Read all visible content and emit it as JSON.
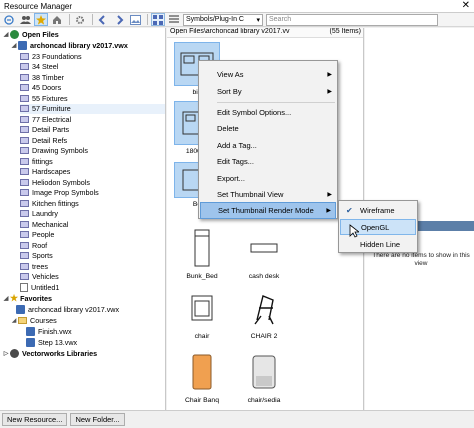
{
  "window": {
    "title": "Resource Manager",
    "close": "✕"
  },
  "toolbar": {
    "filter_label": "Symbols/Plug-In C",
    "search_placeholder": "Search"
  },
  "tree": {
    "open_files": "Open Files",
    "library": "archoncad library v2017.vwx",
    "folders": [
      "23 Foundations",
      "34 Steel",
      "38 Timber",
      "45 Doors",
      "55 Fixtures",
      "57 Furniture",
      "77 Electrical",
      "Detail Parts",
      "Detail Refs",
      "Drawing Symbols",
      "fittings",
      "Hardscapes",
      "Heliodon Symbols",
      "Image Prop Symbols",
      "Kitchen fittings",
      "Laundry",
      "Mechanical",
      "People",
      "Roof",
      "Sports",
      "trees",
      "Vehicles"
    ],
    "untitled": "Untitled1",
    "favorites": "Favorites",
    "fav_library": "archoncad library v2017.vwx",
    "courses": "Courses",
    "finish": "Finish.vwx",
    "step": "Step 13.vwx",
    "vw_libraries": "Vectorworks Libraries"
  },
  "middle": {
    "path": "Open Files\\archoncad library v2017.vv",
    "count": "(55 Items)",
    "partial_labels": [
      "bid",
      "1800x5",
      "Be"
    ],
    "items": [
      {
        "label": "Bunk_Bed",
        "icon": "bunk-bed-icon"
      },
      {
        "label": "cash desk",
        "icon": "cash-desk-icon"
      },
      {
        "label": "chair",
        "icon": "chair-icon"
      },
      {
        "label": "CHAIR 2",
        "icon": "chair-2-icon"
      },
      {
        "label": "Chair Banq",
        "icon": "chair-banq-icon"
      },
      {
        "label": "chair/sedia",
        "icon": "chair-sedia-icon"
      }
    ]
  },
  "context_menu": {
    "items": [
      "View As",
      "Sort By",
      "Edit Symbol Options...",
      "Delete",
      "Add a Tag...",
      "Edit Tags...",
      "Export...",
      "Set Thumbnail View",
      "Set Thumbnail Render Mode"
    ],
    "active": "Set Thumbnail Render Mode"
  },
  "submenu": {
    "items": [
      "Wireframe",
      "OpenGL",
      "Hidden Line"
    ],
    "checked": "Wireframe",
    "hovered": "OpenGL"
  },
  "right": {
    "empty_text": "There are no items to show in this view"
  },
  "bottom": {
    "new_resource": "New Resource...",
    "new_folder": "New Folder..."
  },
  "colors": {
    "selection": "#cfe4f7",
    "menu_highlight": "#9ec4ec",
    "panel_header": "#5c7fa8"
  }
}
